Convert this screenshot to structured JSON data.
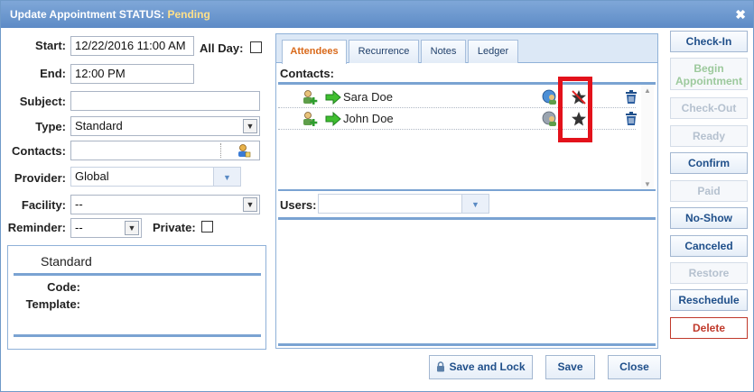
{
  "titlebar": {
    "prefix": "Update Appointment STATUS:",
    "status": "Pending",
    "close_glyph": "✖"
  },
  "form": {
    "start_label": "Start:",
    "start_value": "12/22/2016 11:00 AM",
    "allday_label": "All Day:",
    "end_label": "End:",
    "end_value": "12:00 PM",
    "subject_label": "Subject:",
    "subject_value": "",
    "type_label": "Type:",
    "type_value": "Standard",
    "contacts_label": "Contacts:",
    "contacts_value": "",
    "provider_label": "Provider:",
    "provider_value": "Global",
    "facility_label": "Facility:",
    "facility_value": "--",
    "reminder_label": "Reminder:",
    "reminder_value": "--",
    "private_label": "Private:"
  },
  "type_panel": {
    "title": "Standard",
    "code_label": "Code:",
    "template_label": "Template:"
  },
  "tabs": [
    {
      "label": "Attendees",
      "active": true
    },
    {
      "label": "Recurrence",
      "active": false
    },
    {
      "label": "Notes",
      "active": false
    },
    {
      "label": "Ledger",
      "active": false
    }
  ],
  "attendees": {
    "contacts_label": "Contacts:",
    "contacts": [
      {
        "name": "Sara Doe",
        "star_icon": "star-crossed-icon"
      },
      {
        "name": "John Doe",
        "star_icon": "star-icon"
      }
    ],
    "users_label": "Users:",
    "users_value": ""
  },
  "side_buttons": [
    {
      "label": "Check-In",
      "state": "enabled"
    },
    {
      "label": "Begin Appointment",
      "state": "disabled-green"
    },
    {
      "label": "Check-Out",
      "state": "disabled"
    },
    {
      "label": "Ready",
      "state": "disabled"
    },
    {
      "label": "Confirm",
      "state": "enabled"
    },
    {
      "label": "Paid",
      "state": "disabled"
    },
    {
      "label": "No-Show",
      "state": "enabled"
    },
    {
      "label": "Canceled",
      "state": "enabled"
    },
    {
      "label": "Restore",
      "state": "disabled"
    },
    {
      "label": "Reschedule",
      "state": "enabled"
    },
    {
      "label": "Delete",
      "state": "danger"
    }
  ],
  "footer": {
    "save_lock_label": "Save and Lock",
    "save_label": "Save",
    "close_label": "Close"
  },
  "colors": {
    "titlebar": "#5d8bc6",
    "status_text": "#ffe08a",
    "active_tab": "#d9691a",
    "highlight_box": "#e3121b",
    "delete": "#c0392b"
  }
}
